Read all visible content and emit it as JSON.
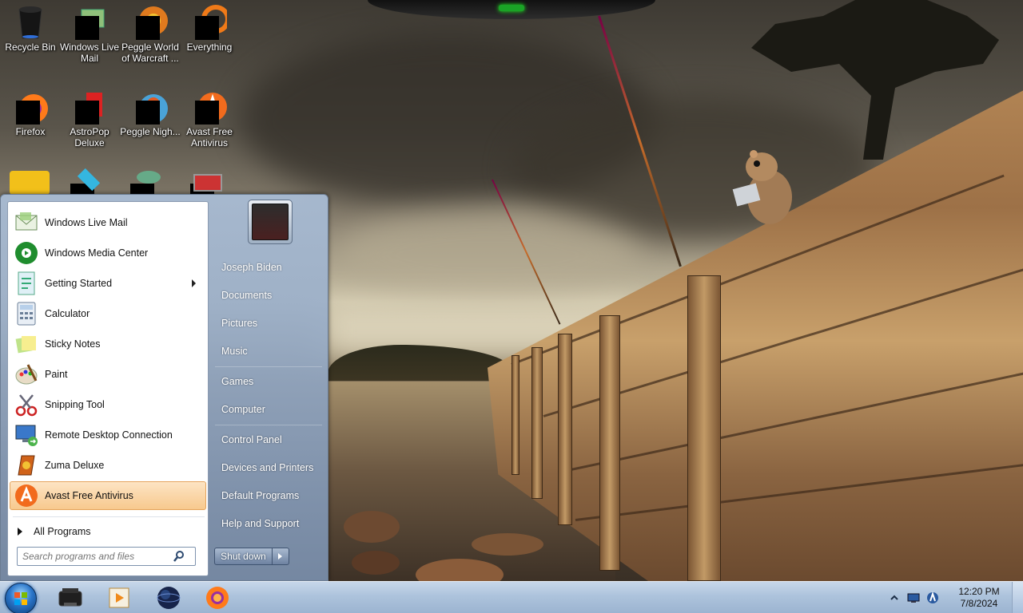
{
  "desktop": {
    "icons": [
      {
        "label": "Recycle Bin",
        "icon": "recycle-bin-icon"
      },
      {
        "label": "Windows Live Mail",
        "icon": "mail-icon"
      },
      {
        "label": "Peggle World of Warcraft ...",
        "icon": "peggle-wow-icon"
      },
      {
        "label": "Everything",
        "icon": "everything-search-icon"
      },
      {
        "label": "Firefox",
        "icon": "firefox-icon"
      },
      {
        "label": "AstroPop Deluxe",
        "icon": "astropop-icon"
      },
      {
        "label": "Peggle Nigh...",
        "icon": "peggle-nights-icon"
      },
      {
        "label": "Avast Free Antivirus",
        "icon": "avast-icon"
      }
    ]
  },
  "start_menu": {
    "programs": [
      {
        "label": "Windows Live Mail",
        "icon": "mail-icon"
      },
      {
        "label": "Windows Media Center",
        "icon": "media-center-icon"
      },
      {
        "label": "Getting Started",
        "icon": "getting-started-icon",
        "has_submenu": true
      },
      {
        "label": "Calculator",
        "icon": "calculator-icon"
      },
      {
        "label": "Sticky Notes",
        "icon": "sticky-notes-icon"
      },
      {
        "label": "Paint",
        "icon": "paint-icon"
      },
      {
        "label": "Snipping Tool",
        "icon": "scissors-icon"
      },
      {
        "label": "Remote Desktop Connection",
        "icon": "remote-desktop-icon"
      },
      {
        "label": "Zuma Deluxe",
        "icon": "zuma-icon"
      },
      {
        "label": "Avast Free Antivirus",
        "icon": "avast-icon",
        "highlighted": true
      }
    ],
    "all_programs": "All Programs",
    "search_placeholder": "Search programs and files",
    "right_links": [
      {
        "label": "Joseph Biden"
      },
      {
        "label": "Documents"
      },
      {
        "label": "Pictures"
      },
      {
        "label": "Music"
      },
      {
        "label": "Games"
      },
      {
        "label": "Computer"
      },
      {
        "label": "Control Panel"
      },
      {
        "label": "Devices and Printers"
      },
      {
        "label": "Default Programs"
      },
      {
        "label": "Help and Support"
      }
    ],
    "shutdown": "Shut down"
  },
  "taskbar": {
    "pinned": [
      {
        "icon": "printer-icon"
      },
      {
        "icon": "media-player-icon"
      },
      {
        "icon": "globe-icon"
      },
      {
        "icon": "firefox-icon"
      }
    ],
    "tray_icons": [
      "show-hidden-icons-icon",
      "network-icon",
      "avast-tray-icon"
    ],
    "time": "12:20 PM",
    "date": "7/8/2024"
  },
  "colors": {
    "taskbar": "#adc3dc",
    "menu_highlight": "#f7c98e",
    "avast_orange": "#f26b1d",
    "firefox_orange": "#ff7a1a"
  }
}
